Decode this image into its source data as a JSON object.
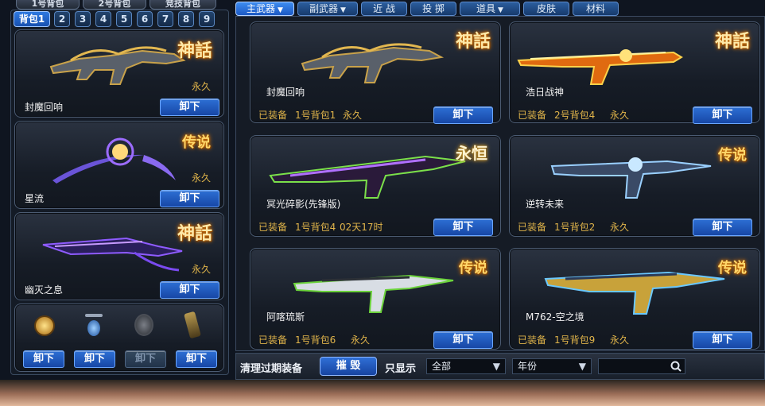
{
  "top_tabs": [
    "1号背包",
    "2号背包",
    "竞技背包"
  ],
  "backpack_tabs": {
    "active": "背包1",
    "numbers": [
      "2",
      "3",
      "4",
      "5",
      "6",
      "7",
      "8",
      "9"
    ]
  },
  "category_tabs": [
    {
      "label": "主武器",
      "has_caret": true
    },
    {
      "label": "副武器",
      "has_caret": true
    },
    {
      "label": "近 战",
      "has_caret": false
    },
    {
      "label": "投 掷",
      "has_caret": false
    },
    {
      "label": "道具",
      "has_caret": true
    },
    {
      "label": "皮肤",
      "has_caret": false
    },
    {
      "label": "材料",
      "has_caret": false
    }
  ],
  "left_slots": [
    {
      "name": "封魔回响",
      "badge": "神話",
      "duration": "永久",
      "button": "卸下"
    },
    {
      "name": "星流",
      "badge": "传说",
      "duration": "永久",
      "button": "卸下"
    },
    {
      "name": "幽灭之息",
      "badge": "神話",
      "duration": "永久",
      "button": "卸下"
    }
  ],
  "left_items": {
    "buttons": [
      "卸下",
      "卸下",
      "卸下",
      "卸下"
    ],
    "icons": [
      "gold-grenade-icon",
      "propeller-bomb-icon",
      "frag-grenade-icon",
      "canister-icon"
    ]
  },
  "grid_items": [
    {
      "name": "封魔回响",
      "badge": "神話",
      "status": "已装备",
      "bag": "1号背包1",
      "time": "永久",
      "button": "卸下"
    },
    {
      "name": "浩日战神",
      "badge": "神話",
      "status": "已装备",
      "bag": "2号背包4",
      "time": "永久",
      "button": "卸下"
    },
    {
      "name": "冥光碎影(先锋版)",
      "badge": "永恒",
      "status": "已装备",
      "bag": "1号背包4",
      "time": "02天17时",
      "button": "卸下"
    },
    {
      "name": "逆转未来",
      "badge": "传说",
      "status": "已装备",
      "bag": "1号背包2",
      "time": "永久",
      "button": "卸下"
    },
    {
      "name": "阿喀琉斯",
      "badge": "传说",
      "status": "已装备",
      "bag": "1号背包6",
      "time": "永久",
      "button": "卸下"
    },
    {
      "name": "M762-空之境",
      "badge": "传说",
      "status": "已装备",
      "bag": "1号背包9",
      "time": "永久",
      "button": "卸下"
    }
  ],
  "bottom_bar": {
    "clear_label": "清理过期装备",
    "destroy_button": "摧 毁",
    "filter_label": "只显示",
    "filter_value": "全部",
    "year_value": "年份",
    "search_value": ""
  },
  "colors": {
    "accent_blue": "#2d6fd4",
    "gold_text": "#e0b44a",
    "panel_border": "#4b5b72"
  }
}
